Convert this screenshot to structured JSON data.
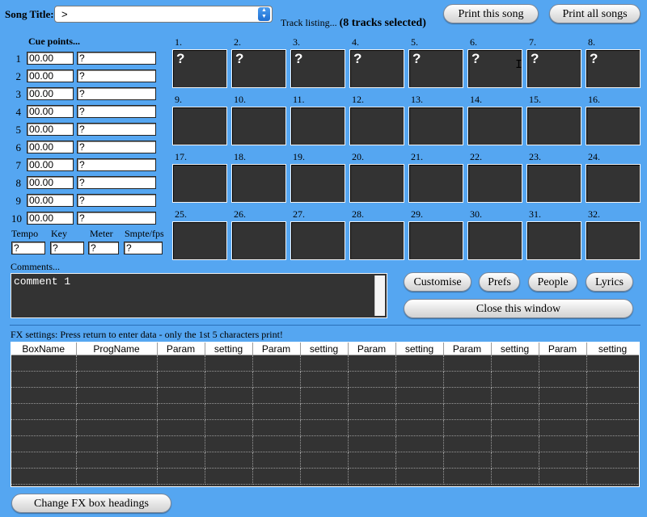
{
  "header": {
    "song_title_label": "Song Title:",
    "song_title_value": ">",
    "track_listing_label": "Track listing...",
    "tracks_selected": "(8 tracks selected)",
    "print_song": "Print this song",
    "print_all": "Print all songs"
  },
  "cue": {
    "heading": "Cue points...",
    "rows": [
      {
        "num": "1",
        "time": "00.00",
        "name": "?"
      },
      {
        "num": "2",
        "time": "00.00",
        "name": "?"
      },
      {
        "num": "3",
        "time": "00.00",
        "name": "?"
      },
      {
        "num": "4",
        "time": "00.00",
        "name": "?"
      },
      {
        "num": "5",
        "time": "00.00",
        "name": "?"
      },
      {
        "num": "6",
        "time": "00.00",
        "name": "?"
      },
      {
        "num": "7",
        "time": "00.00",
        "name": "?"
      },
      {
        "num": "8",
        "time": "00.00",
        "name": "?"
      },
      {
        "num": "9",
        "time": "00.00",
        "name": "?"
      },
      {
        "num": "10",
        "time": "00.00",
        "name": "?"
      }
    ]
  },
  "meta": {
    "tempo_label": "Tempo",
    "tempo_value": "?",
    "key_label": "Key",
    "key_value": "?",
    "meter_label": "Meter",
    "meter_value": "?",
    "smpte_label": "Smpte/fps",
    "smpte_value": "?"
  },
  "tracks": [
    {
      "num": "1.",
      "text": "?"
    },
    {
      "num": "2.",
      "text": "?"
    },
    {
      "num": "3.",
      "text": "?"
    },
    {
      "num": "4.",
      "text": "?"
    },
    {
      "num": "5.",
      "text": "?"
    },
    {
      "num": "6.",
      "text": "?"
    },
    {
      "num": "7.",
      "text": "?"
    },
    {
      "num": "8.",
      "text": "?"
    },
    {
      "num": "9.",
      "text": ""
    },
    {
      "num": "10.",
      "text": ""
    },
    {
      "num": "11.",
      "text": ""
    },
    {
      "num": "12.",
      "text": ""
    },
    {
      "num": "13.",
      "text": ""
    },
    {
      "num": "14.",
      "text": ""
    },
    {
      "num": "15.",
      "text": ""
    },
    {
      "num": "16.",
      "text": ""
    },
    {
      "num": "17.",
      "text": ""
    },
    {
      "num": "18.",
      "text": ""
    },
    {
      "num": "19.",
      "text": ""
    },
    {
      "num": "20.",
      "text": ""
    },
    {
      "num": "21.",
      "text": ""
    },
    {
      "num": "22.",
      "text": ""
    },
    {
      "num": "23.",
      "text": ""
    },
    {
      "num": "24.",
      "text": ""
    },
    {
      "num": "25.",
      "text": ""
    },
    {
      "num": "26.",
      "text": ""
    },
    {
      "num": "27.",
      "text": ""
    },
    {
      "num": "28.",
      "text": ""
    },
    {
      "num": "29.",
      "text": ""
    },
    {
      "num": "30.",
      "text": ""
    },
    {
      "num": "31.",
      "text": ""
    },
    {
      "num": "32.",
      "text": ""
    }
  ],
  "comments": {
    "label": "Comments...",
    "value": "comment 1"
  },
  "buttons": {
    "customise": "Customise",
    "prefs": "Prefs",
    "people": "People",
    "lyrics": "Lyrics",
    "close": "Close this window",
    "change_fx": "Change FX box headings"
  },
  "fx": {
    "note": "FX settings:  Press return to enter data - only the 1st 5 characters print!",
    "headers": [
      "BoxName",
      "ProgName",
      "Param",
      "setting",
      "Param",
      "setting",
      "Param",
      "setting",
      "Param",
      "setting",
      "Param",
      "setting"
    ],
    "row_count": 8
  }
}
